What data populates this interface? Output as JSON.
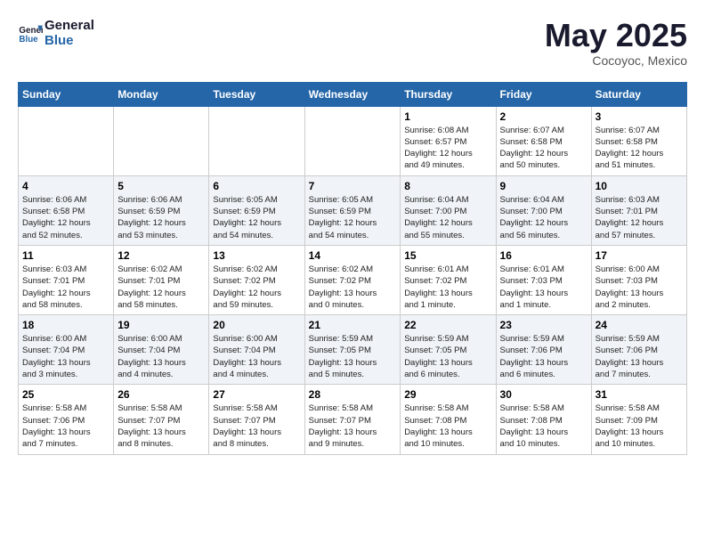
{
  "header": {
    "logo_line1": "General",
    "logo_line2": "Blue",
    "month": "May 2025",
    "location": "Cocoyoc, Mexico"
  },
  "weekdays": [
    "Sunday",
    "Monday",
    "Tuesday",
    "Wednesday",
    "Thursday",
    "Friday",
    "Saturday"
  ],
  "weeks": [
    [
      {
        "day": "",
        "info": ""
      },
      {
        "day": "",
        "info": ""
      },
      {
        "day": "",
        "info": ""
      },
      {
        "day": "",
        "info": ""
      },
      {
        "day": "1",
        "info": "Sunrise: 6:08 AM\nSunset: 6:57 PM\nDaylight: 12 hours\nand 49 minutes."
      },
      {
        "day": "2",
        "info": "Sunrise: 6:07 AM\nSunset: 6:58 PM\nDaylight: 12 hours\nand 50 minutes."
      },
      {
        "day": "3",
        "info": "Sunrise: 6:07 AM\nSunset: 6:58 PM\nDaylight: 12 hours\nand 51 minutes."
      }
    ],
    [
      {
        "day": "4",
        "info": "Sunrise: 6:06 AM\nSunset: 6:58 PM\nDaylight: 12 hours\nand 52 minutes."
      },
      {
        "day": "5",
        "info": "Sunrise: 6:06 AM\nSunset: 6:59 PM\nDaylight: 12 hours\nand 53 minutes."
      },
      {
        "day": "6",
        "info": "Sunrise: 6:05 AM\nSunset: 6:59 PM\nDaylight: 12 hours\nand 54 minutes."
      },
      {
        "day": "7",
        "info": "Sunrise: 6:05 AM\nSunset: 6:59 PM\nDaylight: 12 hours\nand 54 minutes."
      },
      {
        "day": "8",
        "info": "Sunrise: 6:04 AM\nSunset: 7:00 PM\nDaylight: 12 hours\nand 55 minutes."
      },
      {
        "day": "9",
        "info": "Sunrise: 6:04 AM\nSunset: 7:00 PM\nDaylight: 12 hours\nand 56 minutes."
      },
      {
        "day": "10",
        "info": "Sunrise: 6:03 AM\nSunset: 7:01 PM\nDaylight: 12 hours\nand 57 minutes."
      }
    ],
    [
      {
        "day": "11",
        "info": "Sunrise: 6:03 AM\nSunset: 7:01 PM\nDaylight: 12 hours\nand 58 minutes."
      },
      {
        "day": "12",
        "info": "Sunrise: 6:02 AM\nSunset: 7:01 PM\nDaylight: 12 hours\nand 58 minutes."
      },
      {
        "day": "13",
        "info": "Sunrise: 6:02 AM\nSunset: 7:02 PM\nDaylight: 12 hours\nand 59 minutes."
      },
      {
        "day": "14",
        "info": "Sunrise: 6:02 AM\nSunset: 7:02 PM\nDaylight: 13 hours\nand 0 minutes."
      },
      {
        "day": "15",
        "info": "Sunrise: 6:01 AM\nSunset: 7:02 PM\nDaylight: 13 hours\nand 1 minute."
      },
      {
        "day": "16",
        "info": "Sunrise: 6:01 AM\nSunset: 7:03 PM\nDaylight: 13 hours\nand 1 minute."
      },
      {
        "day": "17",
        "info": "Sunrise: 6:00 AM\nSunset: 7:03 PM\nDaylight: 13 hours\nand 2 minutes."
      }
    ],
    [
      {
        "day": "18",
        "info": "Sunrise: 6:00 AM\nSunset: 7:04 PM\nDaylight: 13 hours\nand 3 minutes."
      },
      {
        "day": "19",
        "info": "Sunrise: 6:00 AM\nSunset: 7:04 PM\nDaylight: 13 hours\nand 4 minutes."
      },
      {
        "day": "20",
        "info": "Sunrise: 6:00 AM\nSunset: 7:04 PM\nDaylight: 13 hours\nand 4 minutes."
      },
      {
        "day": "21",
        "info": "Sunrise: 5:59 AM\nSunset: 7:05 PM\nDaylight: 13 hours\nand 5 minutes."
      },
      {
        "day": "22",
        "info": "Sunrise: 5:59 AM\nSunset: 7:05 PM\nDaylight: 13 hours\nand 6 minutes."
      },
      {
        "day": "23",
        "info": "Sunrise: 5:59 AM\nSunset: 7:06 PM\nDaylight: 13 hours\nand 6 minutes."
      },
      {
        "day": "24",
        "info": "Sunrise: 5:59 AM\nSunset: 7:06 PM\nDaylight: 13 hours\nand 7 minutes."
      }
    ],
    [
      {
        "day": "25",
        "info": "Sunrise: 5:58 AM\nSunset: 7:06 PM\nDaylight: 13 hours\nand 7 minutes."
      },
      {
        "day": "26",
        "info": "Sunrise: 5:58 AM\nSunset: 7:07 PM\nDaylight: 13 hours\nand 8 minutes."
      },
      {
        "day": "27",
        "info": "Sunrise: 5:58 AM\nSunset: 7:07 PM\nDaylight: 13 hours\nand 8 minutes."
      },
      {
        "day": "28",
        "info": "Sunrise: 5:58 AM\nSunset: 7:07 PM\nDaylight: 13 hours\nand 9 minutes."
      },
      {
        "day": "29",
        "info": "Sunrise: 5:58 AM\nSunset: 7:08 PM\nDaylight: 13 hours\nand 10 minutes."
      },
      {
        "day": "30",
        "info": "Sunrise: 5:58 AM\nSunset: 7:08 PM\nDaylight: 13 hours\nand 10 minutes."
      },
      {
        "day": "31",
        "info": "Sunrise: 5:58 AM\nSunset: 7:09 PM\nDaylight: 13 hours\nand 10 minutes."
      }
    ]
  ]
}
